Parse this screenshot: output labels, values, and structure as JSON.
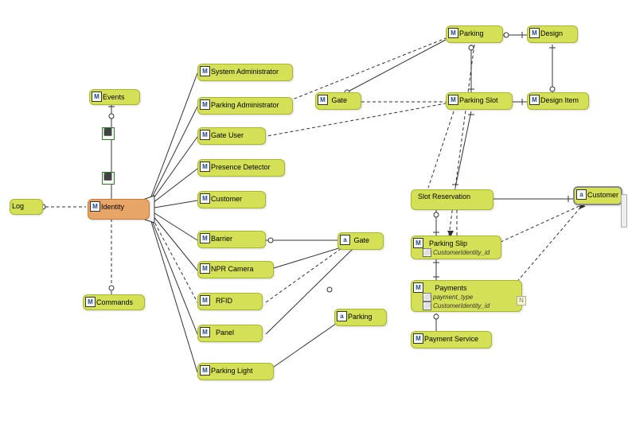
{
  "nodes": {
    "log": {
      "label": "Log"
    },
    "identity": {
      "label": "Identity"
    },
    "events": {
      "label": "Events"
    },
    "commands": {
      "label": "Commands"
    },
    "sysadmin": {
      "label": "System Administrator"
    },
    "parkingadmin": {
      "label": "Parking Administrator"
    },
    "gateuser": {
      "label": "Gate User"
    },
    "presence": {
      "label": "Presence Detector"
    },
    "customer": {
      "label": "Customer"
    },
    "barrier": {
      "label": "Barrier"
    },
    "npr": {
      "label": "NPR Camera"
    },
    "rfid": {
      "label": "RFID"
    },
    "panel": {
      "label": "Panel"
    },
    "parkinglight": {
      "label": "Parking Light"
    },
    "gate": {
      "label": "Gate"
    },
    "gate2": {
      "label": "Gate"
    },
    "parking2": {
      "label": "Parking"
    },
    "parking": {
      "label": "Parking"
    },
    "design": {
      "label": "Design"
    },
    "parkingslot": {
      "label": "Parking Slot"
    },
    "designitem": {
      "label": "Design Item"
    },
    "slotres": {
      "label": "Slot Reservation"
    },
    "parkingslip": {
      "label": "Parking Slip",
      "attrs": [
        "CustomerIdentity_id"
      ]
    },
    "payments": {
      "label": "Payments",
      "attrs": [
        "payment_type",
        "CustomerIdentity_id"
      ]
    },
    "paymentsvc": {
      "label": "Payment Service"
    },
    "customer2": {
      "label": "Customer"
    }
  },
  "chart_data": {
    "type": "diagram",
    "title": "Entity Relationship / Class Diagram",
    "entities": [
      {
        "id": "Log",
        "stereotype": "class"
      },
      {
        "id": "Identity",
        "stereotype": "class",
        "selected": true
      },
      {
        "id": "Events",
        "stereotype": "class"
      },
      {
        "id": "Commands",
        "stereotype": "class"
      },
      {
        "id": "System Administrator",
        "stereotype": "class"
      },
      {
        "id": "Parking Administrator",
        "stereotype": "class"
      },
      {
        "id": "Gate User",
        "stereotype": "class"
      },
      {
        "id": "Presence Detector",
        "stereotype": "class"
      },
      {
        "id": "Customer",
        "stereotype": "class"
      },
      {
        "id": "Barrier",
        "stereotype": "class"
      },
      {
        "id": "NPR Camera",
        "stereotype": "class"
      },
      {
        "id": "RFID",
        "stereotype": "class"
      },
      {
        "id": "Panel",
        "stereotype": "class"
      },
      {
        "id": "Parking Light",
        "stereotype": "class"
      },
      {
        "id": "Gate",
        "stereotype": "class"
      },
      {
        "id": "Gate (agent)",
        "stereotype": "agent"
      },
      {
        "id": "Parking (agent)",
        "stereotype": "agent"
      },
      {
        "id": "Parking",
        "stereotype": "class"
      },
      {
        "id": "Design",
        "stereotype": "class"
      },
      {
        "id": "Parking Slot",
        "stereotype": "class"
      },
      {
        "id": "Design Item",
        "stereotype": "class"
      },
      {
        "id": "Slot Reservation",
        "stereotype": "class"
      },
      {
        "id": "Parking Slip",
        "stereotype": "class",
        "attributes": [
          "CustomerIdentity_id"
        ]
      },
      {
        "id": "Payments",
        "stereotype": "class",
        "attributes": [
          "payment_type",
          "CustomerIdentity_id"
        ]
      },
      {
        "id": "Payment Service",
        "stereotype": "class"
      },
      {
        "id": "Customer (agent)",
        "stereotype": "agent"
      }
    ],
    "edges": [
      {
        "from": "Log",
        "to": "Identity",
        "type": "dependency"
      },
      {
        "from": "Events",
        "to": "Identity",
        "type": "association"
      },
      {
        "from": "Commands",
        "to": "Identity",
        "type": "dependency"
      },
      {
        "from": "Identity",
        "to": "System Administrator",
        "type": "generalization"
      },
      {
        "from": "Identity",
        "to": "Parking Administrator",
        "type": "generalization"
      },
      {
        "from": "Identity",
        "to": "Gate User",
        "type": "generalization"
      },
      {
        "from": "Identity",
        "to": "Presence Detector",
        "type": "generalization"
      },
      {
        "from": "Identity",
        "to": "Customer",
        "type": "generalization"
      },
      {
        "from": "Identity",
        "to": "Barrier",
        "type": "generalization"
      },
      {
        "from": "Identity",
        "to": "NPR Camera",
        "type": "generalization"
      },
      {
        "from": "Identity",
        "to": "RFID",
        "type": "generalization"
      },
      {
        "from": "Identity",
        "to": "Panel",
        "type": "generalization"
      },
      {
        "from": "Identity",
        "to": "Parking Light",
        "type": "generalization"
      },
      {
        "from": "Barrier",
        "to": "Gate (agent)",
        "type": "association"
      },
      {
        "from": "NPR Camera",
        "to": "Gate (agent)",
        "type": "association"
      },
      {
        "from": "RFID",
        "to": "Gate (agent)",
        "type": "dependency"
      },
      {
        "from": "Panel",
        "to": "Gate (agent)",
        "type": "association"
      },
      {
        "from": "Parking Light",
        "to": "Parking (agent)",
        "type": "association"
      },
      {
        "from": "Gate",
        "to": "Parking",
        "type": "association"
      },
      {
        "from": "Gate",
        "to": "Parking Slot",
        "type": "dependency"
      },
      {
        "from": "Parking Administrator",
        "to": "Parking",
        "type": "dependency"
      },
      {
        "from": "Parking",
        "to": "Design",
        "type": "association"
      },
      {
        "from": "Parking",
        "to": "Parking Slot",
        "type": "association"
      },
      {
        "from": "Parking",
        "to": "Parking Slip",
        "type": "dependency"
      },
      {
        "from": "Design",
        "to": "Design Item",
        "type": "association"
      },
      {
        "from": "Parking Slot",
        "to": "Design Item",
        "type": "association"
      },
      {
        "from": "Parking Slot",
        "to": "Slot Reservation",
        "type": "association"
      },
      {
        "from": "Slot Reservation",
        "to": "Parking Slip",
        "type": "association"
      },
      {
        "from": "Slot Reservation",
        "to": "Customer (agent)",
        "type": "association"
      },
      {
        "from": "Parking Slip",
        "to": "Payments",
        "type": "association"
      },
      {
        "from": "Parking Slip",
        "to": "Customer (agent)",
        "type": "dependency"
      },
      {
        "from": "Payments",
        "to": "Payment Service",
        "type": "association"
      },
      {
        "from": "Payments",
        "to": "Customer (agent)",
        "type": "dependency"
      }
    ]
  }
}
